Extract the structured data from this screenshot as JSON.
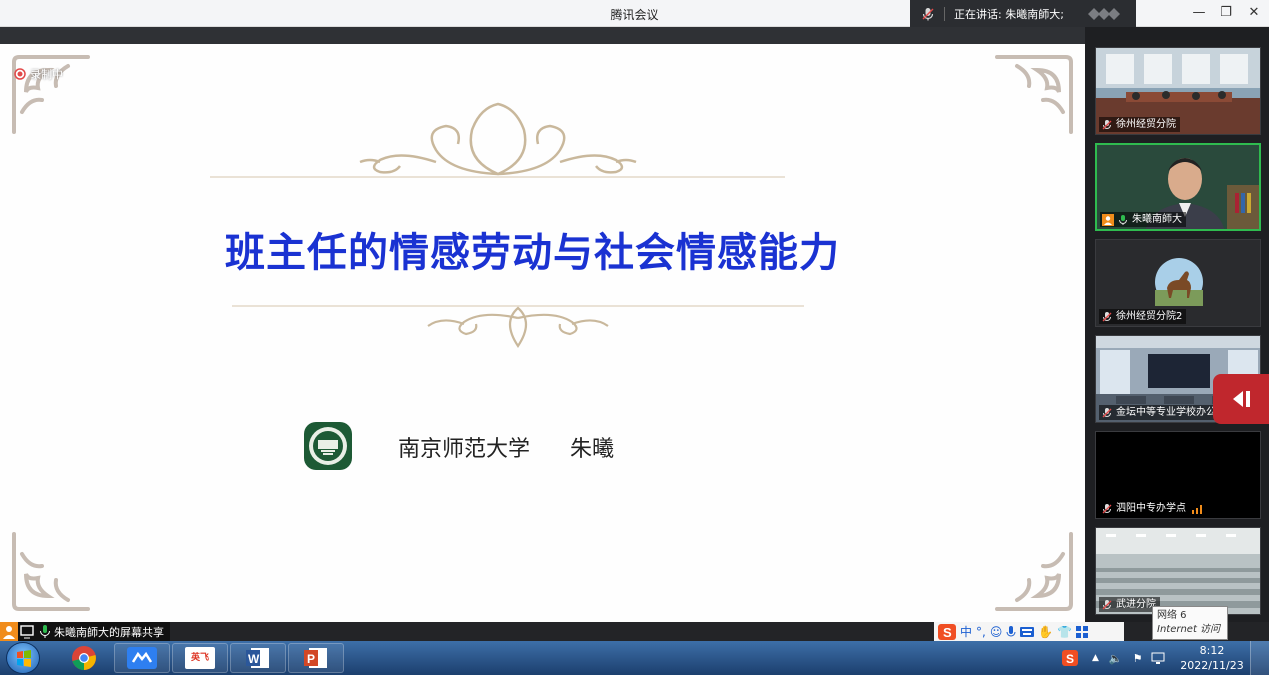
{
  "app": {
    "title": "腾讯会议"
  },
  "speaking": {
    "text": "正在讲话: 朱曦南師大;"
  },
  "window_controls": {
    "minimize": "—",
    "restore": "❐",
    "close": "✕"
  },
  "recording": {
    "label": "录制中"
  },
  "slide": {
    "title": "班主任的情感劳动与社会情感能力",
    "institution": "南京师范大学",
    "author": "朱曦",
    "title_color": "#1a32d2"
  },
  "participants": [
    {
      "name": "徐州经贸分院",
      "video": "meeting-room"
    },
    {
      "name": "朱曦南師大",
      "video": "speaker",
      "active": true,
      "host": true
    },
    {
      "name": "徐州经贸分院2",
      "video": "avatar-horse"
    },
    {
      "name": "金坛中等专业学校办公",
      "video": "classroom"
    },
    {
      "name": "泗阳中专办学点",
      "video": "black",
      "signal": true
    },
    {
      "name": "武进分院",
      "video": "auditorium"
    }
  ],
  "share_status": {
    "text": "朱曦南師大的屏幕共享"
  },
  "ime": {
    "mode": "中",
    "punct": "°,"
  },
  "tooltip": {
    "line1": "网络  6",
    "line2": "Internet 访问"
  },
  "taskbar": {
    "apps": [
      "chrome-icon",
      "tencent-meeting-icon",
      "yingfei-icon",
      "word-icon",
      "powerpoint-icon"
    ],
    "yingfei_label": "英飞"
  },
  "clock": {
    "time": "8:12",
    "date": "2022/11/23"
  },
  "colors": {
    "accent_green": "#2fbb4f",
    "collapse_red": "#c0272d",
    "title_blue": "#1a32d2"
  }
}
